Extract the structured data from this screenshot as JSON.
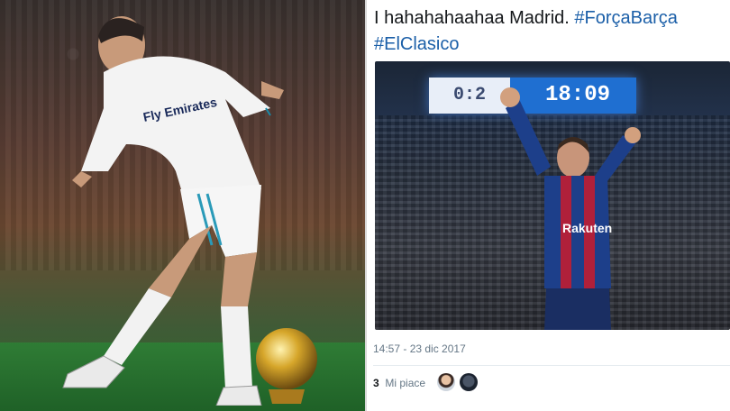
{
  "tweet": {
    "text_prefix": "I hahahahaahaa Madrid.",
    "hashtag1": "#ForçaBarça",
    "hashtag2": "#ElClasico",
    "timestamp": "14:57 - 23 dic 2017",
    "likes_count": "3",
    "likes_label": "Mi piace"
  },
  "left_photo": {
    "jersey_sponsor": "Fly Emirates",
    "object": "ballon-dor-trophy"
  },
  "tweet_photo": {
    "scoreboard_left": "0:2",
    "scoreboard_right": "18:09",
    "jersey_sponsor": "Rakuten"
  },
  "colors": {
    "hashtag": "#1b5fa8",
    "scoreboard": "#1f6fd1",
    "barca_blue": "#1d3f8a",
    "barca_red": "#b0203a",
    "madrid_white": "#f3f3f3",
    "gold": "#d6a62a"
  }
}
